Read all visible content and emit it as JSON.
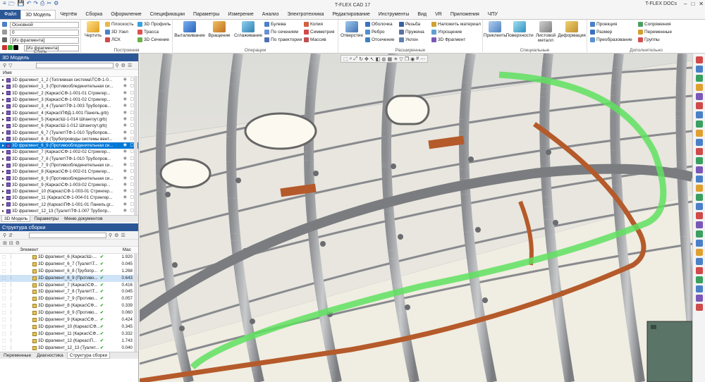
{
  "app": {
    "title": "T-FLEX CAD 17",
    "docs_label": "T-FLEX DOCs",
    "quick_access": [
      "≡",
      "🗁",
      "💾",
      "↶",
      "↷",
      "⎙",
      "✂",
      "⚙"
    ]
  },
  "tabs": [
    {
      "label": "Файл",
      "kind": "file"
    },
    {
      "label": "3D Модель",
      "kind": "active"
    },
    {
      "label": "Чертёж"
    },
    {
      "label": "Сборка"
    },
    {
      "label": "Оформление"
    },
    {
      "label": "Спецификации"
    },
    {
      "label": "Параметры"
    },
    {
      "label": "Измерение"
    },
    {
      "label": "Анализ"
    },
    {
      "label": "Электротехника"
    },
    {
      "label": "Редактирование"
    },
    {
      "label": "Инструменты"
    },
    {
      "label": "Вид"
    },
    {
      "label": "VR"
    },
    {
      "label": "Приложения"
    },
    {
      "label": "ЧПУ"
    }
  ],
  "ribbon": {
    "style": {
      "label": "Стиль",
      "layer": "Основной",
      "line_weight": "0",
      "fragment1": "[Из фрагмента]",
      "fragment2": "[Из фрагмента]"
    },
    "build": {
      "label": "Построения",
      "draw": "Чертить",
      "items": [
        "Плоскость",
        "3D Узел",
        "ЛСК",
        "3D Профиль",
        "Трасса",
        "3D Сечение"
      ]
    },
    "operations": {
      "label": "Операции",
      "big": [
        "Выталкивание",
        "Вращение",
        "Сглаживание"
      ],
      "items": [
        "Булева",
        "По сечениям",
        "По траектории",
        "Копия",
        "Симметрия",
        "Массив"
      ]
    },
    "extended": {
      "label": "Расширенные",
      "big": "Отверстие",
      "items": [
        "Оболочка",
        "Ребро",
        "Отсечение",
        "Резьба",
        "Пружина",
        "Уклон",
        "Наложить материал",
        "Упрощение",
        "3D Фрагмент"
      ]
    },
    "special": {
      "label": "Специальные",
      "big": [
        "Приклеить",
        "Поверхности",
        "Листовой металл",
        "Деформация"
      ]
    },
    "extra": {
      "label": "Дополнительно",
      "items": [
        "Проекция",
        "Размер",
        "Преобразование",
        "Сопряжения",
        "Переменные",
        "Группы"
      ]
    }
  },
  "model_panel": {
    "title": "3D Модель",
    "column": "Имя",
    "rows": [
      "3D фрагмент_1_2 (Топливная система\\ТСФ-1-0...",
      "3D фрагмент_1_3 (Противообледенительная си...",
      "3D фрагмент_2 (Каркас\\СФ-1-001-01 Стрингер...",
      "3D фрагмент_3 (Каркас\\СФ-1-001-02 Стрингер...",
      "3D фрагмент_3_4 (Туалет\\ТФ-1-003 Трубопров...",
      "3D фрагмент_4 (Каркас\\ПФД-1-001 Панель.grb)",
      "3D фрагмент_5 (Каркас\\Ш-1-014 Шпангоут.grb)",
      "3D фрагмент_6 (Каркас\\Ш-1-012 Шпангоут.grb)",
      "3D фрагмент_6_7 (Туалет\\ТФ-1-010 Трубопров...",
      "3D фрагмент_6_8 (Трубопроводы системы вент...",
      "3D фрагмент_6_9 (Противообледенительная си...",
      "3D фрагмент_7 (Каркас\\СФ-1-002-02 Стрингер...",
      "3D фрагмент_7_8 (Туалет\\ТФ-1-010 Трубопров...",
      "3D фрагмент_7_9 (Противообледенительная си...",
      "3D фрагмент_8 (Каркас\\СФ-1-002-01 Стрингер...",
      "3D фрагмент_8_9 (Противообледенительная си...",
      "3D фрагмент_9 (Каркас\\СФ-1-003-02 Стрингер...",
      "3D фрагмент_10 (Каркас\\СФ-1-003-01 Стрингер...",
      "3D фрагмент_11 (Каркас\\СФ-1-004-01 Стрингер...",
      "3D фрагмент_12 (Каркас\\ПФ-1-001-01 Панель.gr...",
      "3D фрагмент_12_13 (Туалет\\ТФ-1-007 Трубопр..."
    ],
    "selected_index": 10,
    "tabs": [
      "3D Модель",
      "Параметры",
      "Меню документов"
    ]
  },
  "assembly_panel": {
    "title": "Структура сборки",
    "col_element": "Элемент",
    "col_mass": "Mac",
    "rows": [
      {
        "name": "3D фрагмент_6 (Каркас\\Ш-...",
        "mass": "1.920"
      },
      {
        "name": "3D фрагмент_6_7 (Туалет\\Т...",
        "mass": "0.045"
      },
      {
        "name": "3D фрагмент_6_8 (Трубопр...",
        "mass": "1.268"
      },
      {
        "name": "3D фрагмент_6_9 (Противо...",
        "mass": "0.643"
      },
      {
        "name": "3D фрагмент_7 (Каркас\\СФ...",
        "mass": "0.416"
      },
      {
        "name": "3D фрагмент_7_8 (Туалет\\Т...",
        "mass": "0.045"
      },
      {
        "name": "3D фрагмент_7_9 (Противо...",
        "mass": "0.057"
      },
      {
        "name": "3D фрагмент_8 (Каркас\\СФ...",
        "mass": "0.339"
      },
      {
        "name": "3D фрагмент_8_9 (Противо...",
        "mass": "0.060"
      },
      {
        "name": "3D фрагмент_9 (Каркас\\СФ...",
        "mass": "0.424"
      },
      {
        "name": "3D фрагмент_10 (Каркас\\СФ...",
        "mass": "0.345"
      },
      {
        "name": "3D фрагмент_11 (Каркас\\СФ...",
        "mass": "0.332"
      },
      {
        "name": "3D фрагмент_12 (Каркас\\П...",
        "mass": "1.743"
      },
      {
        "name": "3D фрагмент_12_13 (Туалет...",
        "mass": "0.040"
      }
    ],
    "selected_index": 3,
    "tabs": [
      "Переменные",
      "Диагностика",
      "Структура сборки"
    ]
  },
  "colors": {
    "accent": "#2b5797",
    "selection": "#0078d7",
    "pipe_green": "#5fe05f",
    "pipe_copper": "#b55a2a"
  }
}
